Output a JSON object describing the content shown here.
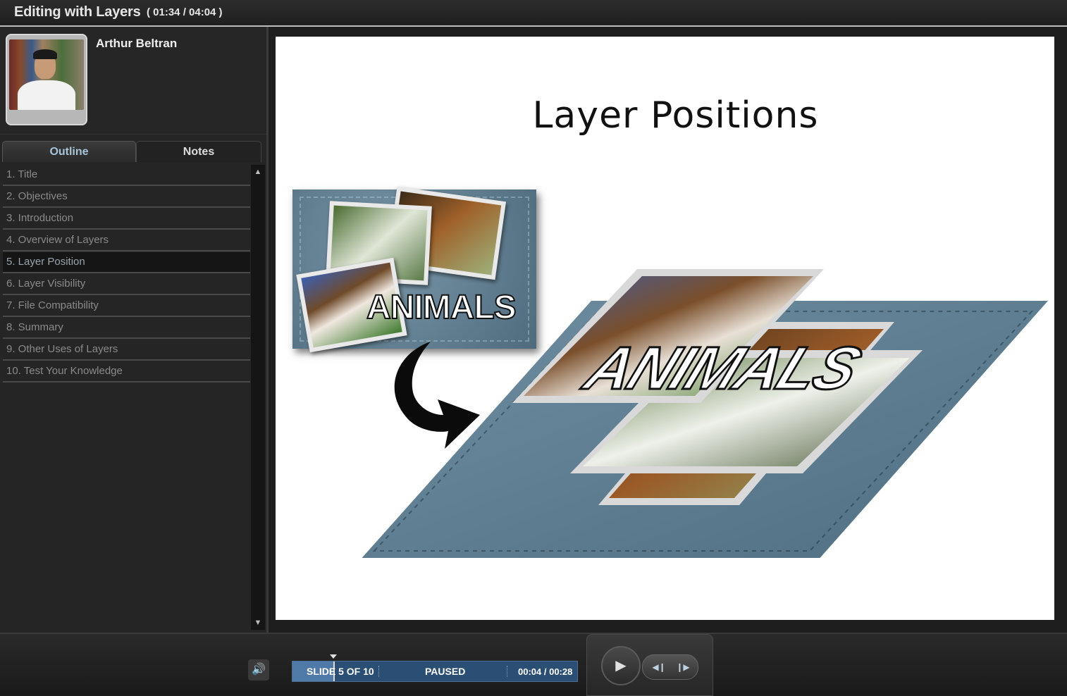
{
  "header": {
    "course_title": "Editing with Layers",
    "course_time": "( 01:34 / 04:04 )"
  },
  "presenter": {
    "name": "Arthur Beltran"
  },
  "tabs": [
    {
      "label": "Outline",
      "active": true
    },
    {
      "label": "Notes",
      "active": false
    }
  ],
  "outline": {
    "items": [
      {
        "label": "1. Title"
      },
      {
        "label": "2. Objectives"
      },
      {
        "label": "3. Introduction"
      },
      {
        "label": "4. Overview of Layers"
      },
      {
        "label": "5. Layer Position",
        "current": true
      },
      {
        "label": "6. Layer Visibility"
      },
      {
        "label": "7. File Compatibility"
      },
      {
        "label": "8. Summary"
      },
      {
        "label": "9. Other Uses of Layers"
      },
      {
        "label": "10. Test Your Knowledge"
      }
    ]
  },
  "slide": {
    "title": "Layer Positions",
    "small_card_text": "ANIMALS",
    "big_card_text": "ANIMALS"
  },
  "controls": {
    "slide_counter": "SLIDE 5 OF 10",
    "status": "PAUSED",
    "time": "00:04 / 00:28",
    "progress_fraction": 0.143,
    "icons": {
      "volume": "volume-icon",
      "play": "play-icon",
      "rewind": "rewind-icon",
      "forward": "forward-icon"
    }
  }
}
